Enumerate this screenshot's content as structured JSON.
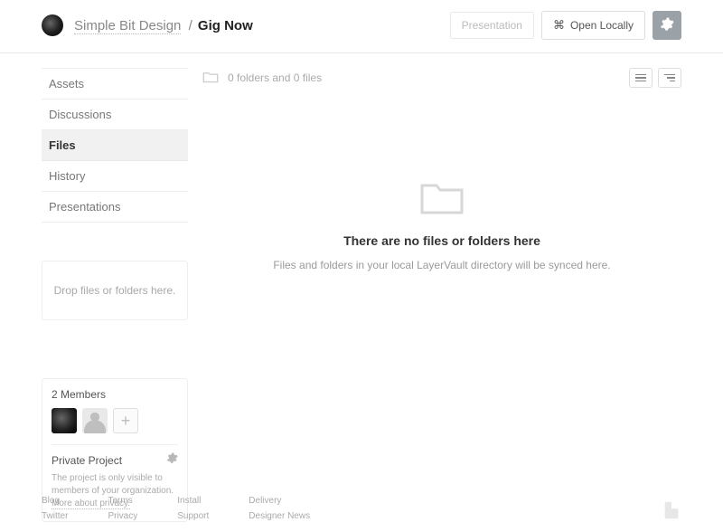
{
  "header": {
    "breadcrumb_parent": "Simple Bit Design",
    "breadcrumb_sep": "/",
    "breadcrumb_current": "Gig Now",
    "presentation_label": "Presentation",
    "open_locally_label": "Open Locally"
  },
  "sidebar": {
    "nav": [
      {
        "label": "Assets",
        "active": false
      },
      {
        "label": "Discussions",
        "active": false
      },
      {
        "label": "Files",
        "active": true
      },
      {
        "label": "History",
        "active": false
      },
      {
        "label": "Presentations",
        "active": false
      }
    ],
    "dropzone": "Drop files or folders here.",
    "members_title": "2 Members",
    "privacy_title": "Private Project",
    "privacy_text": "The project is only visible to members of your organization. ",
    "privacy_link": "More about privacy."
  },
  "main": {
    "folder_count_text": "0 folders and 0 files",
    "empty_title": "There are no files or folders here",
    "empty_sub": "Files and folders in your local LayerVault directory will be synced here."
  },
  "footer": {
    "cols": [
      [
        "Blog",
        "Twitter"
      ],
      [
        "Terms",
        "Privacy"
      ],
      [
        "Install",
        "Support"
      ],
      [
        "Delivery",
        "Designer News"
      ]
    ]
  }
}
